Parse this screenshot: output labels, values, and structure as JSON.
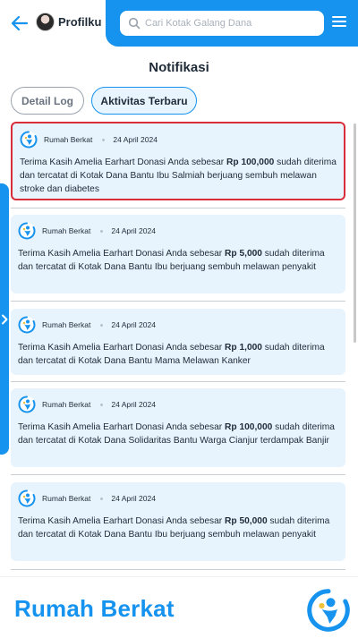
{
  "header": {
    "profile_label": "Profilku",
    "search_placeholder": "Cari Kotak Galang Dana"
  },
  "page": {
    "title": "Notifikasi"
  },
  "tabs": [
    {
      "label": "Detail Log",
      "active": false
    },
    {
      "label": "Aktivitas Terbaru",
      "active": true
    }
  ],
  "notifications": [
    {
      "source": "Rumah Berkat",
      "date": "24 April 2024",
      "pre": "Terima Kasih Amelia Earhart Donasi Anda sebesar ",
      "amount": "Rp 100,000",
      "post": " sudah diterima dan tercatat di Kotak Dana Bantu Ibu Salmiah berjuang sembuh melawan stroke dan diabetes",
      "selected": true
    },
    {
      "source": "Rumah Berkat",
      "date": "24 April 2024",
      "pre": "Terima Kasih Amelia Earhart Donasi Anda sebesar ",
      "amount": "Rp 5,000",
      "post": " sudah diterima dan tercatat di Kotak Dana Bantu Ibu berjuang sembuh melawan penyakit",
      "selected": false
    },
    {
      "source": "Rumah Berkat",
      "date": "24 April 2024",
      "pre": "Terima Kasih Amelia Earhart Donasi Anda sebesar ",
      "amount": "Rp 1,000",
      "post": " sudah diterima dan tercatat di Kotak Dana Bantu Mama Melawan Kanker",
      "selected": false
    },
    {
      "source": "Rumah Berkat",
      "date": "24 April 2024",
      "pre": "Terima Kasih Amelia Earhart Donasi Anda sebesar ",
      "amount": "Rp 100,000",
      "post": " sudah diterima dan tercatat di Kotak Dana Solidaritas Bantu Warga Cianjur terdampak Banjir",
      "selected": false
    },
    {
      "source": "Rumah Berkat",
      "date": "24 April 2024",
      "pre": "Terima Kasih Amelia Earhart Donasi Anda sebesar ",
      "amount": "Rp 50,000",
      "post": " sudah diterima dan tercatat di Kotak Dana Bantu Ibu berjuang sembuh melawan penyakit",
      "selected": false
    }
  ],
  "footer": {
    "brand": "Rumah Berkat"
  },
  "colors": {
    "primary": "#1693ee",
    "card_bg": "#e8f4fd",
    "highlight_border": "#d92d3a",
    "text": "#1f2a37"
  },
  "icons": {
    "back": "arrow-left-icon",
    "search": "search-icon",
    "menu": "hamburger-menu-icon",
    "side": "chevron-right-icon",
    "logo": "rumah-berkat-logo"
  }
}
